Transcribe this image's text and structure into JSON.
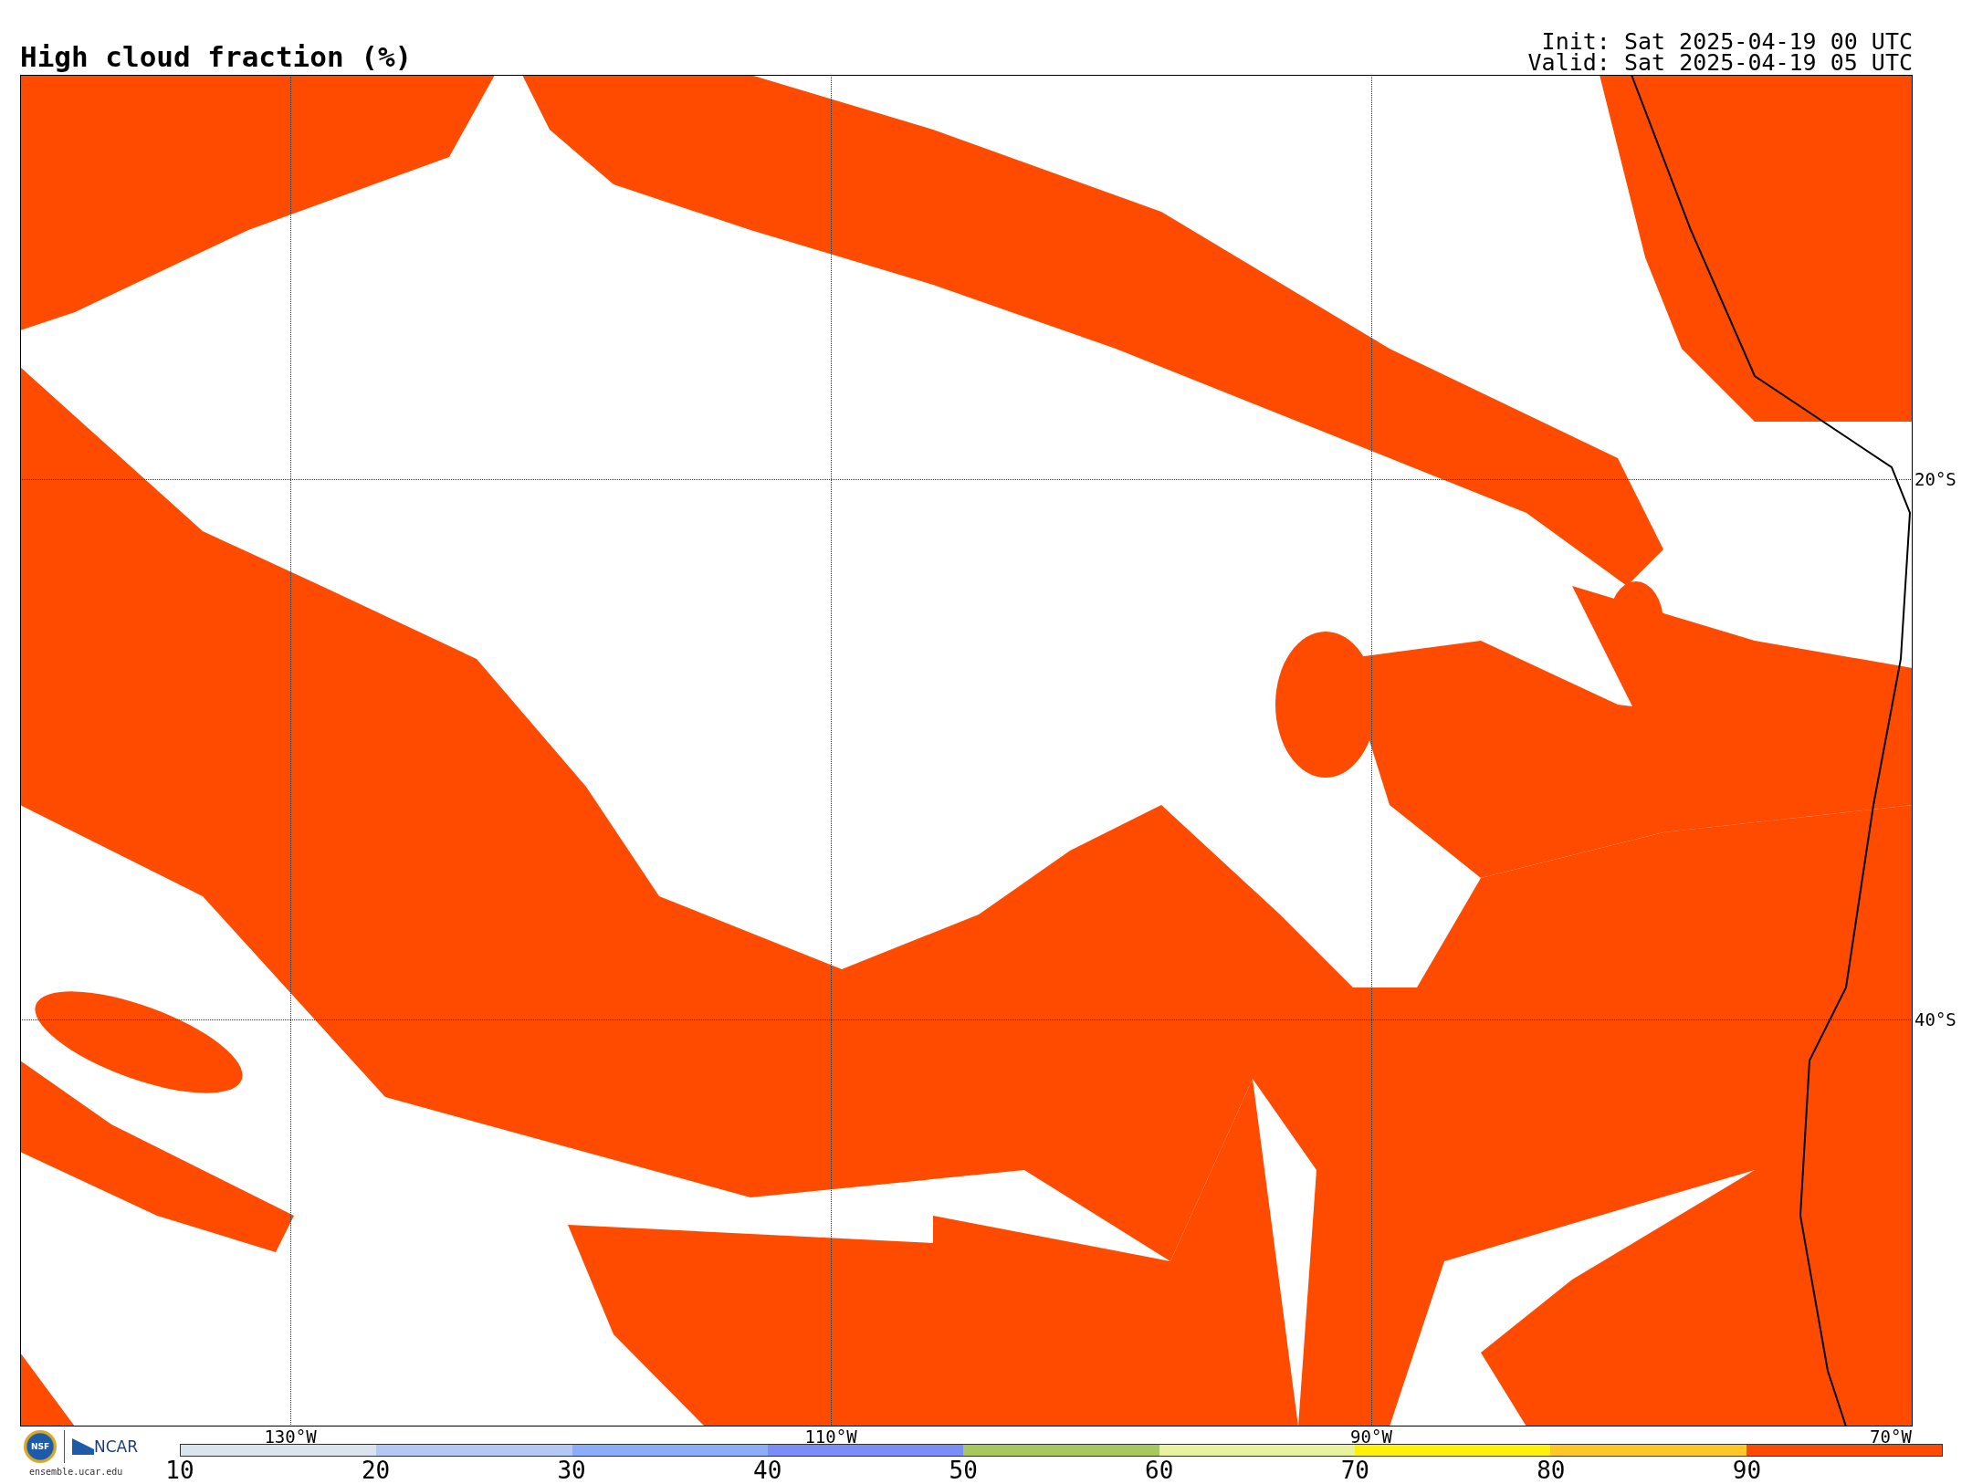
{
  "title": "High cloud fraction (%)",
  "init": "Init: Sat 2025-04-19 00 UTC",
  "valid": "Valid: Sat 2025-04-19 05 UTC",
  "map": {
    "lat_lines": [
      {
        "label": "20°S"
      },
      {
        "label": "40°S"
      }
    ],
    "lon_lines": [
      {
        "label": "130°W"
      },
      {
        "label": "110°W"
      },
      {
        "label": "90°W"
      },
      {
        "label": "70°W"
      }
    ]
  },
  "logo": {
    "seal": "NSF",
    "name": "NCAR",
    "url": "ensemble.ucar.edu"
  },
  "colorbar": {
    "ticks": [
      "10",
      "20",
      "30",
      "40",
      "50",
      "60",
      "70",
      "80",
      "90"
    ],
    "bins": [
      {
        "color": "#d9e4ec"
      },
      {
        "color": "#b3c8f5"
      },
      {
        "color": "#8cadf8"
      },
      {
        "color": "#7b8ef7"
      },
      {
        "color": "#a5c85f"
      },
      {
        "color": "#e8f2a0"
      },
      {
        "color": "#fff20a"
      },
      {
        "color": "#ffc822"
      },
      {
        "color": "#ff4b00"
      }
    ]
  }
}
